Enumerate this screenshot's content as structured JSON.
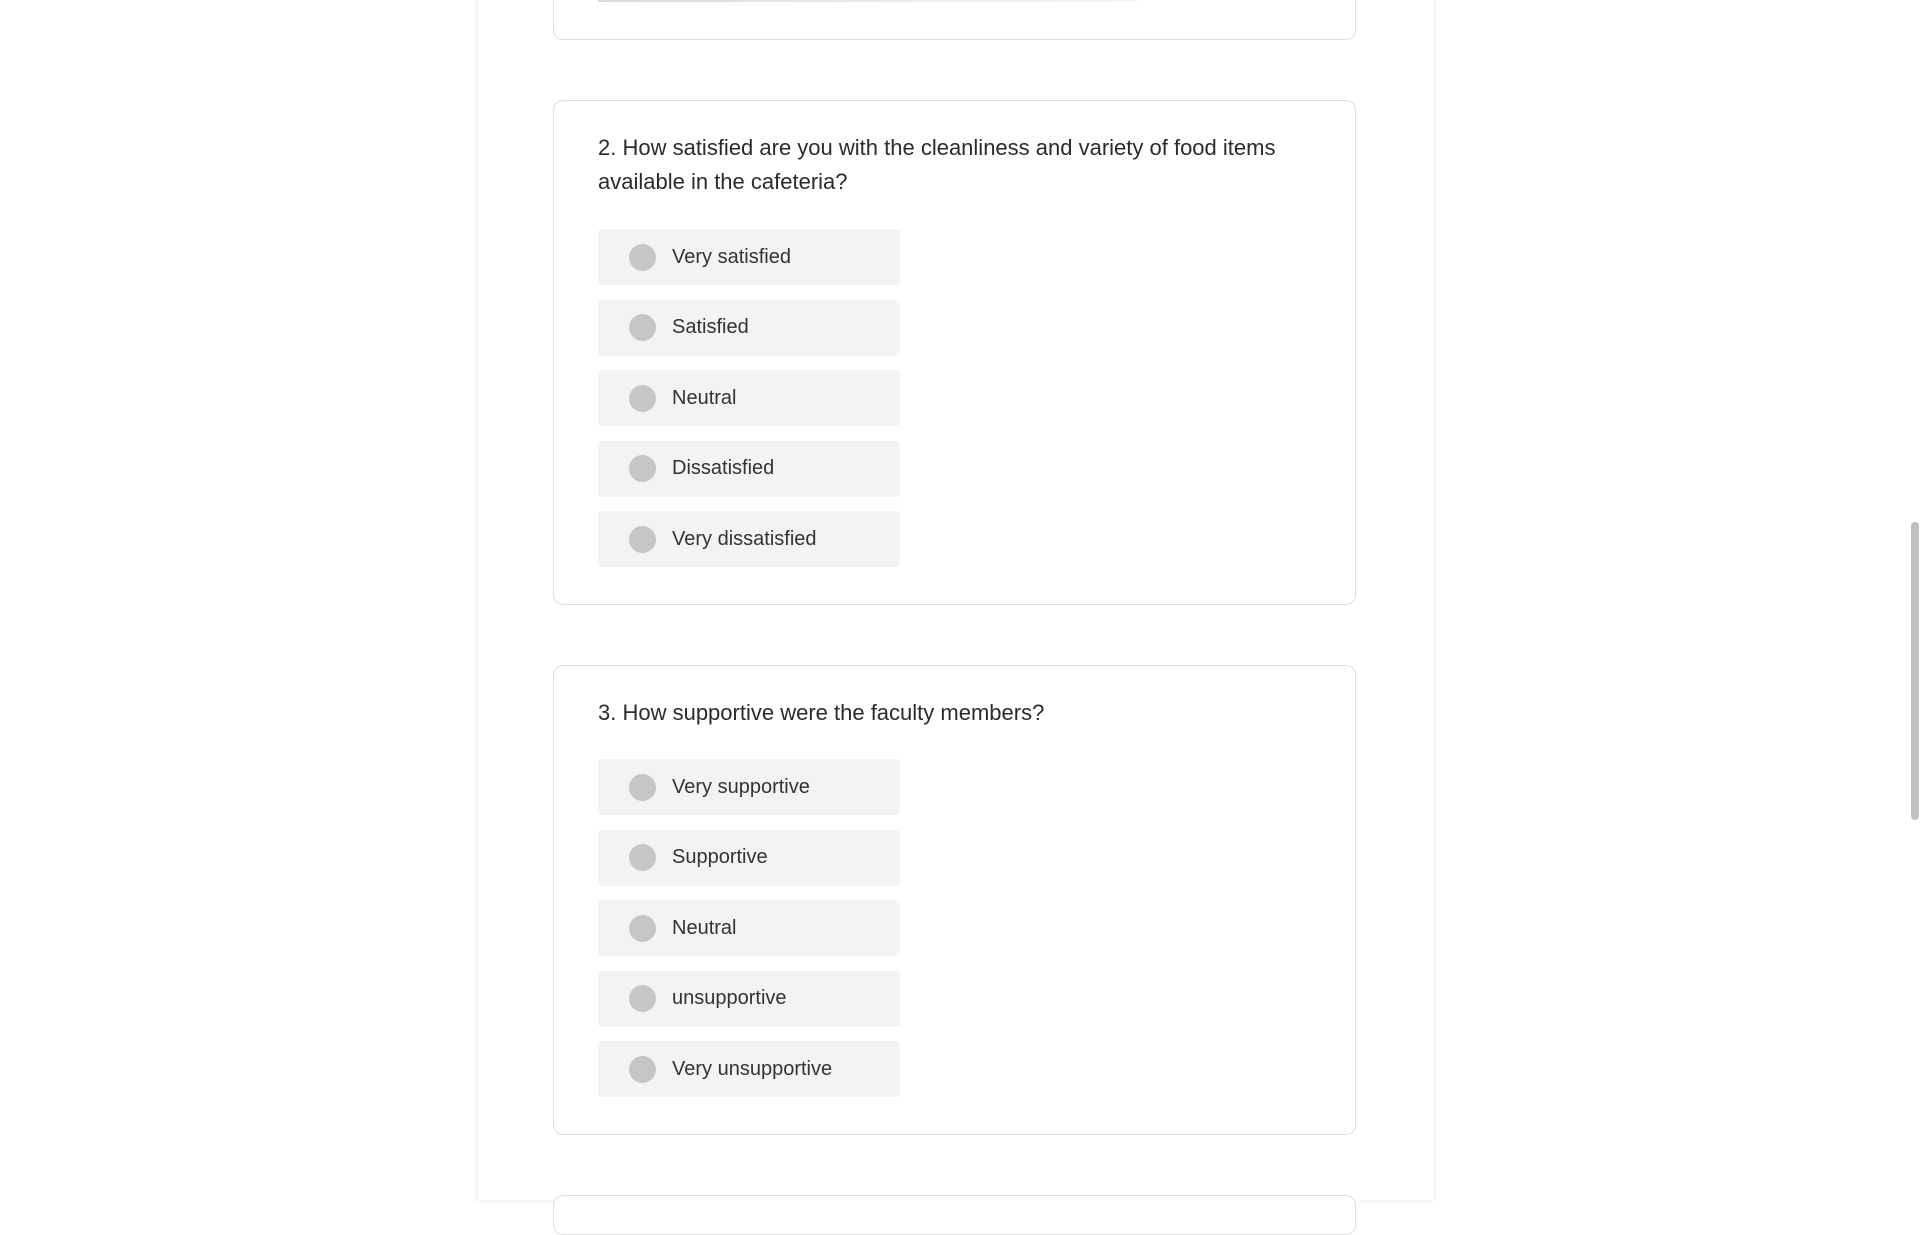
{
  "questions": [
    {
      "title": "2. How satisfied are you with the cleanliness and variety of food items available in the cafeteria?",
      "options": [
        "Very satisfied",
        "Satisfied",
        "Neutral",
        "Dissatisfied",
        "Very dissatisfied"
      ]
    },
    {
      "title": "3. How supportive were the faculty members?",
      "options": [
        "Very supportive",
        "Supportive",
        "Neutral",
        "unsupportive",
        "Very unsupportive"
      ]
    }
  ],
  "colors": {
    "option_bg": "#f3f3f3",
    "radio": "#c6c6c6",
    "card_border": "#dedede",
    "text": "#2b2b2b"
  }
}
